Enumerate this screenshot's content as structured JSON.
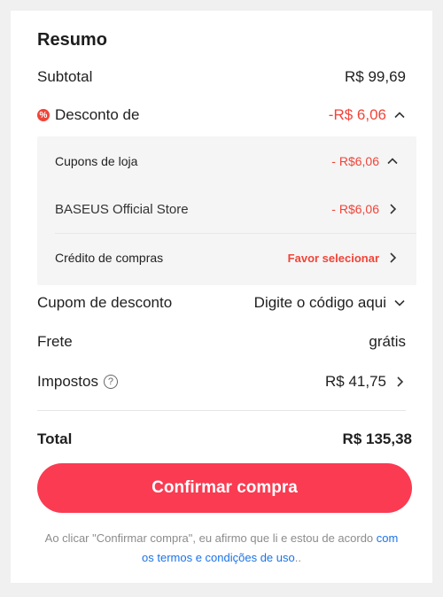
{
  "summary": {
    "title": "Resumo",
    "subtotal": {
      "label": "Subtotal",
      "value": "R$ 99,69"
    },
    "discount": {
      "icon": "discount-icon",
      "label": "Desconto de",
      "value": "-R$ 6,06",
      "details": {
        "store_coupons": {
          "label": "Cupons de loja",
          "value": "- R$6,06"
        },
        "store": {
          "label": "BASEUS Official Store",
          "value": "- R$6,06"
        },
        "shopping_credit": {
          "label": "Crédito de compras",
          "value": "Favor selecionar"
        }
      }
    },
    "coupon": {
      "label": "Cupom de desconto",
      "value": "Digite o código aqui"
    },
    "shipping": {
      "label": "Frete",
      "value": "grátis"
    },
    "taxes": {
      "label": "Impostos",
      "value": "R$ 41,75"
    },
    "total": {
      "label": "Total",
      "value": "R$ 135,38"
    }
  },
  "confirm_button": "Confirmar compra",
  "legal": {
    "text_part1": "Ao clicar \"Confirmar compra\", eu afirmo que li e estou de acordo ",
    "link": "com os termos e condições de uso",
    "text_part2": ".."
  },
  "colors": {
    "accent": "#fa3b52",
    "discount": "#f04438",
    "link": "#1a73e8"
  }
}
